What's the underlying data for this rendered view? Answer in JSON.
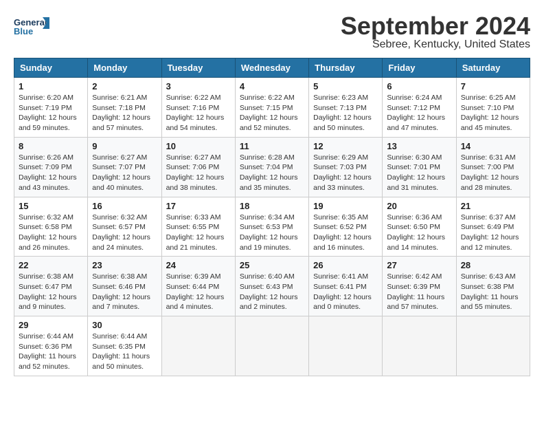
{
  "logo": {
    "line1": "General",
    "line2": "Blue"
  },
  "title": "September 2024",
  "subtitle": "Sebree, Kentucky, United States",
  "days_of_week": [
    "Sunday",
    "Monday",
    "Tuesday",
    "Wednesday",
    "Thursday",
    "Friday",
    "Saturday"
  ],
  "weeks": [
    [
      {
        "day": "1",
        "info": "Sunrise: 6:20 AM\nSunset: 7:19 PM\nDaylight: 12 hours\nand 59 minutes."
      },
      {
        "day": "2",
        "info": "Sunrise: 6:21 AM\nSunset: 7:18 PM\nDaylight: 12 hours\nand 57 minutes."
      },
      {
        "day": "3",
        "info": "Sunrise: 6:22 AM\nSunset: 7:16 PM\nDaylight: 12 hours\nand 54 minutes."
      },
      {
        "day": "4",
        "info": "Sunrise: 6:22 AM\nSunset: 7:15 PM\nDaylight: 12 hours\nand 52 minutes."
      },
      {
        "day": "5",
        "info": "Sunrise: 6:23 AM\nSunset: 7:13 PM\nDaylight: 12 hours\nand 50 minutes."
      },
      {
        "day": "6",
        "info": "Sunrise: 6:24 AM\nSunset: 7:12 PM\nDaylight: 12 hours\nand 47 minutes."
      },
      {
        "day": "7",
        "info": "Sunrise: 6:25 AM\nSunset: 7:10 PM\nDaylight: 12 hours\nand 45 minutes."
      }
    ],
    [
      {
        "day": "8",
        "info": "Sunrise: 6:26 AM\nSunset: 7:09 PM\nDaylight: 12 hours\nand 43 minutes."
      },
      {
        "day": "9",
        "info": "Sunrise: 6:27 AM\nSunset: 7:07 PM\nDaylight: 12 hours\nand 40 minutes."
      },
      {
        "day": "10",
        "info": "Sunrise: 6:27 AM\nSunset: 7:06 PM\nDaylight: 12 hours\nand 38 minutes."
      },
      {
        "day": "11",
        "info": "Sunrise: 6:28 AM\nSunset: 7:04 PM\nDaylight: 12 hours\nand 35 minutes."
      },
      {
        "day": "12",
        "info": "Sunrise: 6:29 AM\nSunset: 7:03 PM\nDaylight: 12 hours\nand 33 minutes."
      },
      {
        "day": "13",
        "info": "Sunrise: 6:30 AM\nSunset: 7:01 PM\nDaylight: 12 hours\nand 31 minutes."
      },
      {
        "day": "14",
        "info": "Sunrise: 6:31 AM\nSunset: 7:00 PM\nDaylight: 12 hours\nand 28 minutes."
      }
    ],
    [
      {
        "day": "15",
        "info": "Sunrise: 6:32 AM\nSunset: 6:58 PM\nDaylight: 12 hours\nand 26 minutes."
      },
      {
        "day": "16",
        "info": "Sunrise: 6:32 AM\nSunset: 6:57 PM\nDaylight: 12 hours\nand 24 minutes."
      },
      {
        "day": "17",
        "info": "Sunrise: 6:33 AM\nSunset: 6:55 PM\nDaylight: 12 hours\nand 21 minutes."
      },
      {
        "day": "18",
        "info": "Sunrise: 6:34 AM\nSunset: 6:53 PM\nDaylight: 12 hours\nand 19 minutes."
      },
      {
        "day": "19",
        "info": "Sunrise: 6:35 AM\nSunset: 6:52 PM\nDaylight: 12 hours\nand 16 minutes."
      },
      {
        "day": "20",
        "info": "Sunrise: 6:36 AM\nSunset: 6:50 PM\nDaylight: 12 hours\nand 14 minutes."
      },
      {
        "day": "21",
        "info": "Sunrise: 6:37 AM\nSunset: 6:49 PM\nDaylight: 12 hours\nand 12 minutes."
      }
    ],
    [
      {
        "day": "22",
        "info": "Sunrise: 6:38 AM\nSunset: 6:47 PM\nDaylight: 12 hours\nand 9 minutes."
      },
      {
        "day": "23",
        "info": "Sunrise: 6:38 AM\nSunset: 6:46 PM\nDaylight: 12 hours\nand 7 minutes."
      },
      {
        "day": "24",
        "info": "Sunrise: 6:39 AM\nSunset: 6:44 PM\nDaylight: 12 hours\nand 4 minutes."
      },
      {
        "day": "25",
        "info": "Sunrise: 6:40 AM\nSunset: 6:43 PM\nDaylight: 12 hours\nand 2 minutes."
      },
      {
        "day": "26",
        "info": "Sunrise: 6:41 AM\nSunset: 6:41 PM\nDaylight: 12 hours\nand 0 minutes."
      },
      {
        "day": "27",
        "info": "Sunrise: 6:42 AM\nSunset: 6:39 PM\nDaylight: 11 hours\nand 57 minutes."
      },
      {
        "day": "28",
        "info": "Sunrise: 6:43 AM\nSunset: 6:38 PM\nDaylight: 11 hours\nand 55 minutes."
      }
    ],
    [
      {
        "day": "29",
        "info": "Sunrise: 6:44 AM\nSunset: 6:36 PM\nDaylight: 11 hours\nand 52 minutes."
      },
      {
        "day": "30",
        "info": "Sunrise: 6:44 AM\nSunset: 6:35 PM\nDaylight: 11 hours\nand 50 minutes."
      },
      null,
      null,
      null,
      null,
      null
    ]
  ]
}
